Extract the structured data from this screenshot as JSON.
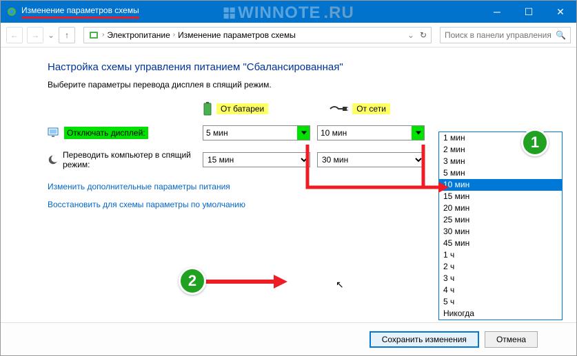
{
  "window": {
    "title": "Изменение параметров схемы",
    "watermark_left": "WINNOTE",
    "watermark_right": ".RU"
  },
  "toolbar": {
    "nav_back": "←",
    "nav_fwd": "→",
    "nav_up": "↑",
    "breadcrumb_items": [
      "Электропитание",
      "Изменение параметров схемы"
    ],
    "search_placeholder": "Поиск в панели управления",
    "refresh": "↻",
    "dropdown": "⌄"
  },
  "page": {
    "heading": "Настройка схемы управления питанием \"Сбалансированная\"",
    "subtitle": "Выберите параметры перевода дисплея в спящий режим.",
    "col_battery": "От батареи",
    "col_ac": "От сети",
    "row_display": "Отключать дисплей:",
    "row_sleep": "Переводить компьютер в спящий режим:",
    "display_battery": "5 мин",
    "display_ac": "10 мин",
    "sleep_battery": "15 мин",
    "sleep_ac": "30 мин",
    "link_advanced": "Изменить дополнительные параметры питания",
    "link_restore": "Восстановить для схемы параметры по умолчанию"
  },
  "dropdown_options": [
    "1 мин",
    "2 мин",
    "3 мин",
    "5 мин",
    "10 мин",
    "15 мин",
    "20 мин",
    "25 мин",
    "30 мин",
    "45 мин",
    "1 ч",
    "2 ч",
    "3 ч",
    "4 ч",
    "5 ч",
    "Никогда"
  ],
  "dropdown_selected": "10 мин",
  "footer": {
    "save": "Сохранить изменения",
    "cancel": "Отмена"
  },
  "badges": {
    "one": "1",
    "two": "2"
  }
}
